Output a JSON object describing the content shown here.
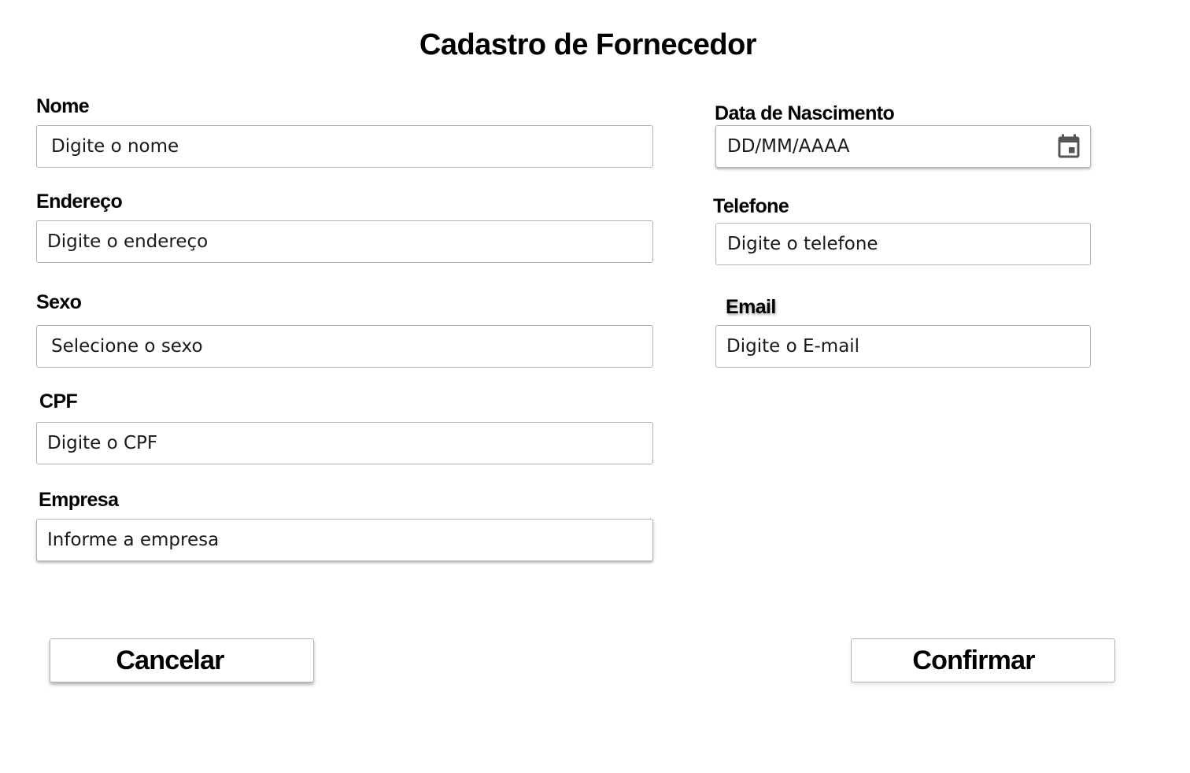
{
  "page": {
    "title": "Cadastro de Fornecedor"
  },
  "form": {
    "nome": {
      "label": "Nome",
      "placeholder": "Digite o nome"
    },
    "endereco": {
      "label": "Endereço",
      "placeholder": "Digite o endereço"
    },
    "sexo": {
      "label": "Sexo",
      "placeholder": "Selecione o sexo"
    },
    "cpf": {
      "label": "CPF",
      "placeholder": "Digite o CPF"
    },
    "empresa": {
      "label": "Empresa",
      "placeholder": "Informe a empresa"
    },
    "data_nascimento": {
      "label": "Data de Nascimento",
      "placeholder": "DD/MM/AAAA",
      "icon": "calendar-icon"
    },
    "telefone": {
      "label": "Telefone",
      "placeholder": "Digite o telefone"
    },
    "email": {
      "label": "Email",
      "placeholder": "Digite o E-mail"
    }
  },
  "actions": {
    "cancel_label": "Cancelar",
    "confirm_label": "Confirmar"
  },
  "colors": {
    "border": "#b3b3b3",
    "text": "#000000",
    "background": "#ffffff",
    "icon": "#555555"
  }
}
